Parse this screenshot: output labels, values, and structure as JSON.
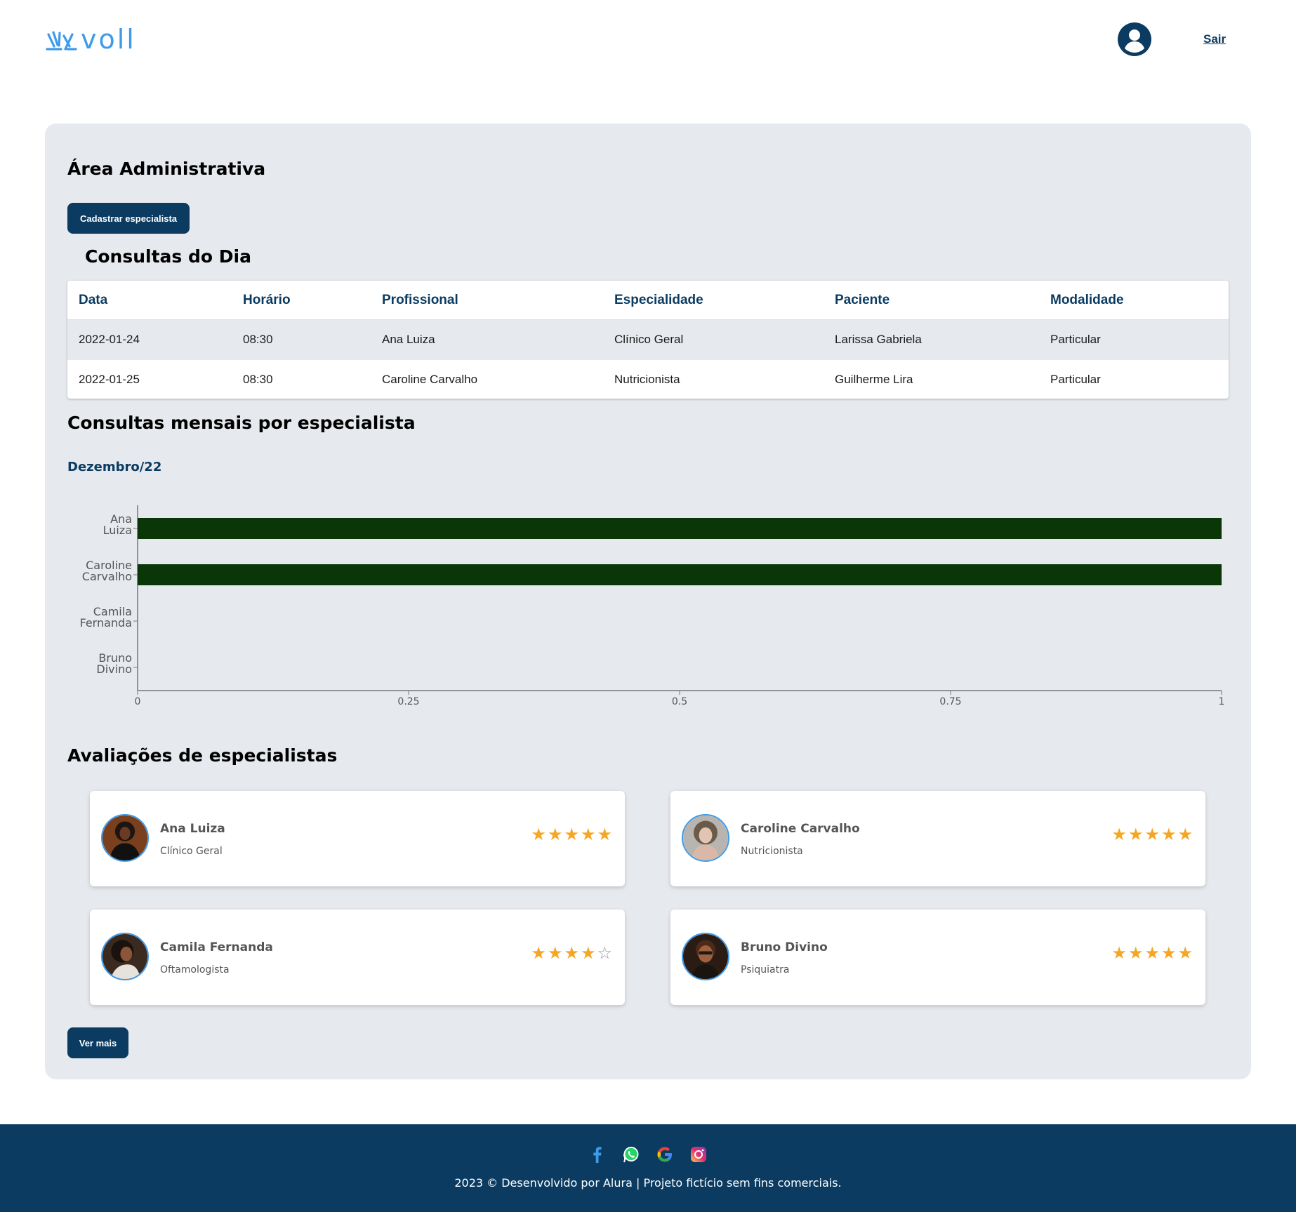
{
  "header": {
    "logo_text": "voll",
    "logout_label": "Sair"
  },
  "admin": {
    "title": "Área Administrativa",
    "register_button": "Cadastrar especialista"
  },
  "consultas": {
    "title": "Consultas do Dia",
    "columns": [
      "Data",
      "Horário",
      "Profissional",
      "Especialidade",
      "Paciente",
      "Modalidade"
    ],
    "rows": [
      [
        "2022-01-24",
        "08:30",
        "Ana Luiza",
        "Clínico Geral",
        "Larissa Gabriela",
        "Particular"
      ],
      [
        "2022-01-25",
        "08:30",
        "Caroline Carvalho",
        "Nutricionista",
        "Guilherme Lira",
        "Particular"
      ]
    ]
  },
  "mensais": {
    "title": "Consultas mensais por especialista",
    "month": "Dezembro/22"
  },
  "chart_data": {
    "type": "bar",
    "orientation": "horizontal",
    "categories": [
      "Ana Luiza",
      "Caroline Carvalho",
      "Camila Fernanda",
      "Bruno Divino"
    ],
    "category_lines": [
      [
        "Ana",
        "Luiza"
      ],
      [
        "Caroline",
        "Carvalho"
      ],
      [
        "Camila",
        "Fernanda"
      ],
      [
        "Bruno",
        "Divino"
      ]
    ],
    "values": [
      1,
      1,
      0,
      0
    ],
    "xlim": [
      0,
      1
    ],
    "xticks": [
      "0",
      "0.25",
      "0.5",
      "0.75",
      "1"
    ],
    "bar_color": "#0A3608",
    "grid": false
  },
  "avaliacoes": {
    "title": "Avaliações de especialistas",
    "cards": [
      {
        "name": "Ana Luiza",
        "specialty": "Clínico Geral",
        "rating": 5
      },
      {
        "name": "Caroline Carvalho",
        "specialty": "Nutricionista",
        "rating": 5
      },
      {
        "name": "Camila Fernanda",
        "specialty": "Oftamologista",
        "rating": 4
      },
      {
        "name": "Bruno Divino",
        "specialty": "Psiquiatra",
        "rating": 5
      }
    ],
    "more_button": "Ver mais"
  },
  "footer": {
    "icons": [
      "facebook-icon",
      "whatsapp-icon",
      "google-icon",
      "instagram-icon"
    ],
    "copyright": "2023 © Desenvolvido por Alura | Projeto fictício sem fins comerciais."
  },
  "colors": {
    "primary": "#0B3B60",
    "accent": "#3E9BEA",
    "panel_bg": "#E6E9EE",
    "star": "#F5A623"
  }
}
